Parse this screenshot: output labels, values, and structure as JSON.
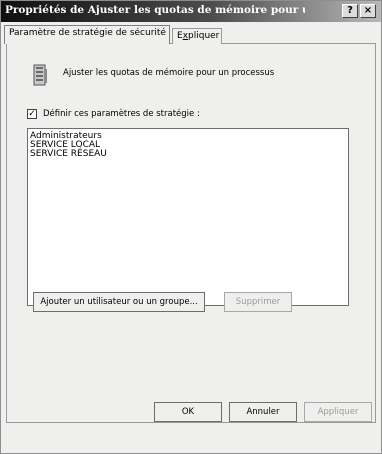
{
  "window": {
    "title": "Propriétés de Ajuster les quotas de mémoire pour un processus",
    "help_label": "?",
    "close_label": "×"
  },
  "tabs": [
    {
      "label": "Paramètre de stratégie de sécurité",
      "active": true
    },
    {
      "label_pre": "E",
      "label_u": "x",
      "label_post": "pliquer",
      "active": false
    }
  ],
  "policy": {
    "icon": "policy-settings-icon",
    "title": "Ajuster les quotas de mémoire pour un processus"
  },
  "define_checkbox": {
    "checked": true,
    "mark": "✓",
    "label": "Définir ces paramètres de stratégie :"
  },
  "accounts": [
    "Administrateurs",
    "SERVICE LOCAL",
    "SERVICE RÉSEAU"
  ],
  "buttons": {
    "add": "Ajouter un utilisateur ou un groupe...",
    "remove": "Supprimer",
    "ok": "OK",
    "cancel": "Annuler",
    "apply": "Appliquer"
  }
}
